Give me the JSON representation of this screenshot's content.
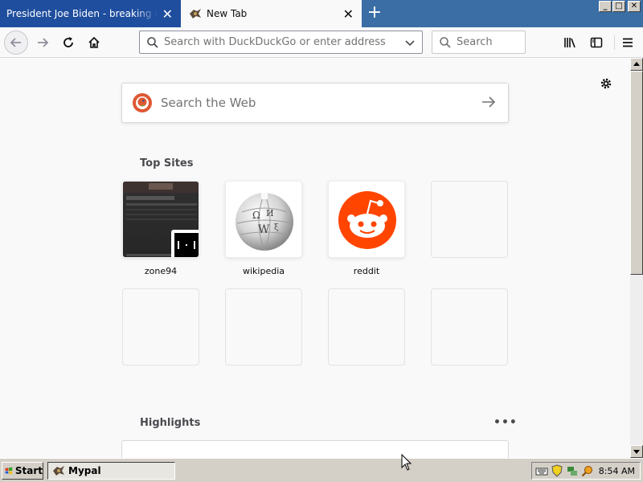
{
  "tabs": [
    {
      "title": "President Joe Biden - breaking news, v",
      "active": false
    },
    {
      "title": "New Tab",
      "active": true
    }
  ],
  "window_controls": {
    "minimize": "_",
    "maximize": "□",
    "close": "✕"
  },
  "toolbar": {
    "url_placeholder": "Search with DuckDuckGo or enter address",
    "search_placeholder": "Search"
  },
  "newtab": {
    "search_placeholder": "Search the Web",
    "top_sites_title": "Top Sites",
    "top_sites": [
      {
        "label": "zone94",
        "icon": "zone94-screenshot"
      },
      {
        "label": "wikipedia",
        "icon": "wikipedia-globe-icon"
      },
      {
        "label": "reddit",
        "icon": "reddit-icon"
      },
      {
        "label": "",
        "icon": ""
      },
      {
        "label": "",
        "icon": ""
      },
      {
        "label": "",
        "icon": ""
      },
      {
        "label": "",
        "icon": ""
      },
      {
        "label": "",
        "icon": ""
      }
    ],
    "highlights_title": "Highlights",
    "highlights_more": "•••"
  },
  "taskbar": {
    "start_label": "Start",
    "task_label": "Mypal",
    "clock": "8:54 AM"
  },
  "colors": {
    "reddit": "#ff4500",
    "tab_active_bg": "#f9f9fa",
    "tab_inactive_bg": "#1f4e9e",
    "duckduckgo": "#de5833"
  }
}
